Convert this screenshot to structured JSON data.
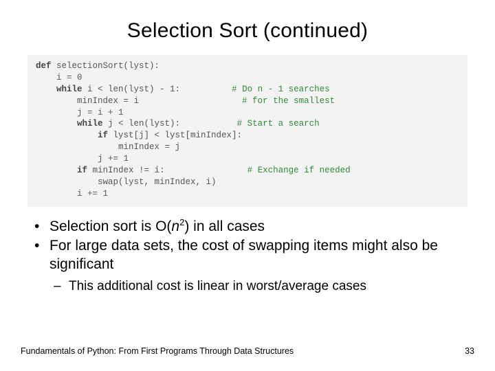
{
  "title": "Selection Sort (continued)",
  "code": {
    "l1a": "def",
    "l1b": " selectionSort(lyst):",
    "l2": "    i = 0",
    "l3a": "    ",
    "l3k": "while",
    "l3b": " i < len(lyst) - 1:",
    "l3c": "          # Do n - 1 searches",
    "l4": "        minIndex = i",
    "l4c": "                    # for the smallest",
    "l5": "        j = i + 1",
    "l6a": "        ",
    "l6k": "while",
    "l6b": " j < len(lyst):",
    "l6c": "           # Start a search",
    "l7a": "            ",
    "l7k": "if",
    "l7b": " lyst[j] < lyst[minIndex]:",
    "l8": "                minIndex = j",
    "l9": "            j += 1",
    "l10a": "        ",
    "l10k": "if",
    "l10b": " minIndex != i:",
    "l10c": "                # Exchange if needed",
    "l11": "            swap(lyst, minIndex, i)",
    "l12": "        i += 1"
  },
  "bullets": {
    "b1": {
      "pre": "Selection sort is O(",
      "n": "n",
      "exp": "2",
      "post": ") in all cases"
    },
    "b2": "For large data sets, the cost of swapping items might also be significant",
    "sub1": "This additional cost is linear in worst/average cases"
  },
  "footer": {
    "left": "Fundamentals of Python: From First Programs Through Data Structures",
    "right": "33"
  }
}
